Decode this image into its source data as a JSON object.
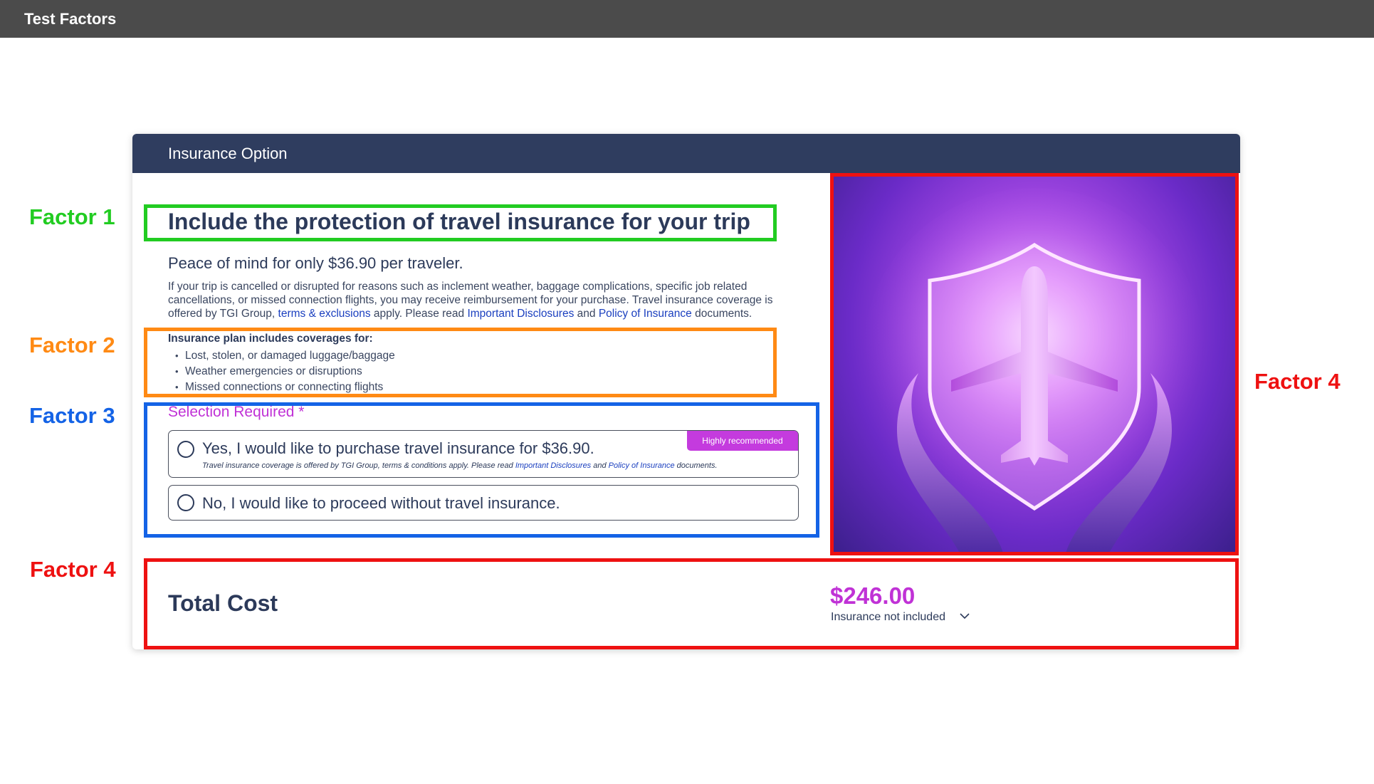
{
  "topbar": {
    "title": "Test Factors"
  },
  "card": {
    "header_title": "Insurance Option",
    "headline": "Include the protection of travel insurance for your trip",
    "subhead": "Peace of mind for only $36.90 per traveler.",
    "description": {
      "text_1": "If your trip is cancelled or disrupted for reasons such as inclement weather, baggage complications, specific job related cancellations, or missed connection flights, you may receive reimbursement for your purchase. Travel insurance coverage is offered by TGI Group, ",
      "link_terms": "terms & exclusions",
      "text_2": " apply. Please read ",
      "link_disclosures": "Important Disclosures",
      "text_3": " and ",
      "link_policy": "Policy of Insurance",
      "text_4": " documents."
    },
    "coverage": {
      "title": "Insurance plan includes coverages for:",
      "items": [
        "Lost, stolen, or damaged luggage/baggage",
        "Weather emergencies or disruptions",
        "Missed connections or connecting flights"
      ]
    },
    "selection_required": "Selection Required *",
    "option_yes": {
      "label": "Yes, I would like to purchase travel insurance for $36.90.",
      "badge": "Highly recommended",
      "note_1": "Travel insurance coverage is offered by TGI Group, terms & conditions apply. Please read ",
      "note_link_disclosures": "Important Disclosures",
      "note_2": " and ",
      "note_link_policy": "Policy of Insurance",
      "note_3": " documents."
    },
    "option_no": {
      "label": "No, I would like to proceed without travel insurance."
    },
    "total": {
      "label": "Total Cost",
      "value": "$246.00",
      "sub": "Insurance not included"
    }
  },
  "annotations": {
    "factor_1": "Factor 1",
    "factor_2": "Factor 2",
    "factor_3": "Factor 3",
    "factor_4_image": "Factor 4",
    "factor_4_total": "Factor 4"
  },
  "colors": {
    "brand_navy": "#2f3d5f",
    "accent_magenta": "#c032d6",
    "link_blue": "#1a3fbf",
    "factor_green": "#22cc22",
    "factor_orange": "#ff8a14",
    "factor_blue": "#1463e6",
    "factor_red": "#ee1111"
  }
}
